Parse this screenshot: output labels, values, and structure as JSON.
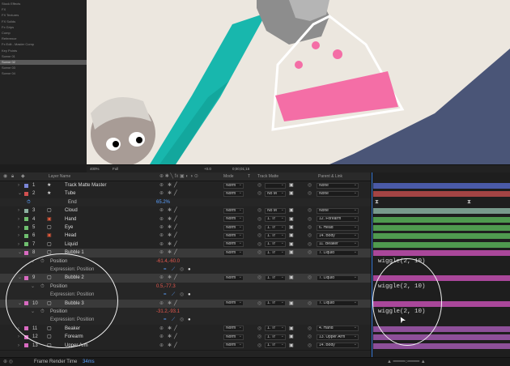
{
  "project_panel": {
    "items": [
      "Stock Effects",
      "FX",
      "FX Textures",
      "FX Solids",
      "Fx Grips",
      "Comp",
      "Reference",
      "Fx Edit - Master Comp",
      "Key Points",
      "Scene 01",
      "Scene 02",
      "Scene 03",
      "Scene 04"
    ],
    "selected_index": 10
  },
  "viewer": {
    "zoom": "400%",
    "resolution": "Full",
    "timecode": "0;00;01;15",
    "plus_value": "+0.0"
  },
  "columns": {
    "name": "Layer Name",
    "mode": "Mode",
    "t": "T",
    "trkmat": "Track Matte",
    "parent": "Parent & Link"
  },
  "layers": [
    {
      "num": "1",
      "name": "Track Matte Master",
      "color": "#7b86d6",
      "mode": "Norm",
      "trk": "",
      "parent": "None",
      "kind": "star",
      "bar": "#4a5aa8",
      "expanded": false
    },
    {
      "num": "2",
      "name": "Tube",
      "color": "#d05050",
      "mode": "Norm",
      "trk": "No M",
      "parent": "None",
      "kind": "star",
      "bar": "#a34444",
      "expanded": true
    },
    {
      "num": "3",
      "name": "Cloud",
      "color": "#8cb0a0",
      "mode": "Norm",
      "trk": "No M",
      "parent": "None",
      "kind": "box",
      "bar": "#789a8c",
      "expanded": false
    },
    {
      "num": "4",
      "name": "Hand",
      "color": "#6fbf6f",
      "mode": "Norm",
      "trk": "1. Tr",
      "parent": "12. Forearm",
      "kind": "red",
      "bar": "#4f9a4f",
      "expanded": false
    },
    {
      "num": "5",
      "name": "Eye",
      "color": "#6fbf6f",
      "mode": "Norm",
      "trk": "1. Tr",
      "parent": "6. Head",
      "kind": "box",
      "bar": "#4f9a4f",
      "expanded": false
    },
    {
      "num": "6",
      "name": "Head",
      "color": "#6fbf6f",
      "mode": "Norm",
      "trk": "1. Tr",
      "parent": "14. Body",
      "kind": "red",
      "bar": "#4f9a4f",
      "expanded": false
    },
    {
      "num": "7",
      "name": "Liquid",
      "color": "#6fbf6f",
      "mode": "Norm",
      "trk": "1. Tr",
      "parent": "11. Beaker",
      "kind": "box",
      "bar": "#4f9a4f",
      "expanded": false
    },
    {
      "num": "8",
      "name": "Bubble 1",
      "color": "#d86ac0",
      "mode": "Norm",
      "trk": "1. Tr",
      "parent": "7. Liquid",
      "kind": "box",
      "bar": "#a9479a",
      "expanded": true
    },
    {
      "num": "9",
      "name": "Bubble 2",
      "color": "#d86ac0",
      "mode": "Norm",
      "trk": "1. Tr",
      "parent": "7. Liquid",
      "kind": "box",
      "bar": "#a9479a",
      "expanded": true
    },
    {
      "num": "10",
      "name": "Bubble 3",
      "color": "#d86ac0",
      "mode": "Norm",
      "trk": "1. Tr",
      "parent": "7. Liquid",
      "kind": "box",
      "bar": "#a9479a",
      "expanded": true
    },
    {
      "num": "11",
      "name": "Beaker",
      "color": "#d86ac0",
      "mode": "Norm",
      "trk": "1. Tr",
      "parent": "4. Hand",
      "kind": "box",
      "bar": "#8d4f99",
      "expanded": false
    },
    {
      "num": "12",
      "name": "Forearm",
      "color": "#d86ac0",
      "mode": "Norm",
      "trk": "1. Tr",
      "parent": "13. Upper Arm",
      "kind": "box",
      "bar": "#8d4f99",
      "expanded": false
    },
    {
      "num": "13",
      "name": "Upper Arm",
      "color": "#d86ac0",
      "mode": "Norm",
      "trk": "1. Tr",
      "parent": "14. Body",
      "kind": "box",
      "bar": "#8d4f99",
      "expanded": false
    }
  ],
  "tube_end": {
    "label": "End",
    "value": "65.2%"
  },
  "bubble1_position": "-61.4,-60.0",
  "bubble2_position": "0.5,-77.3",
  "bubble3_position": "-31.2,-93.1",
  "position_label": "Position",
  "expression_label": "Expression: Position",
  "expression_text": "wiggle(2, 10)",
  "status": {
    "label": "Frame Render Time",
    "value": "34ms"
  }
}
